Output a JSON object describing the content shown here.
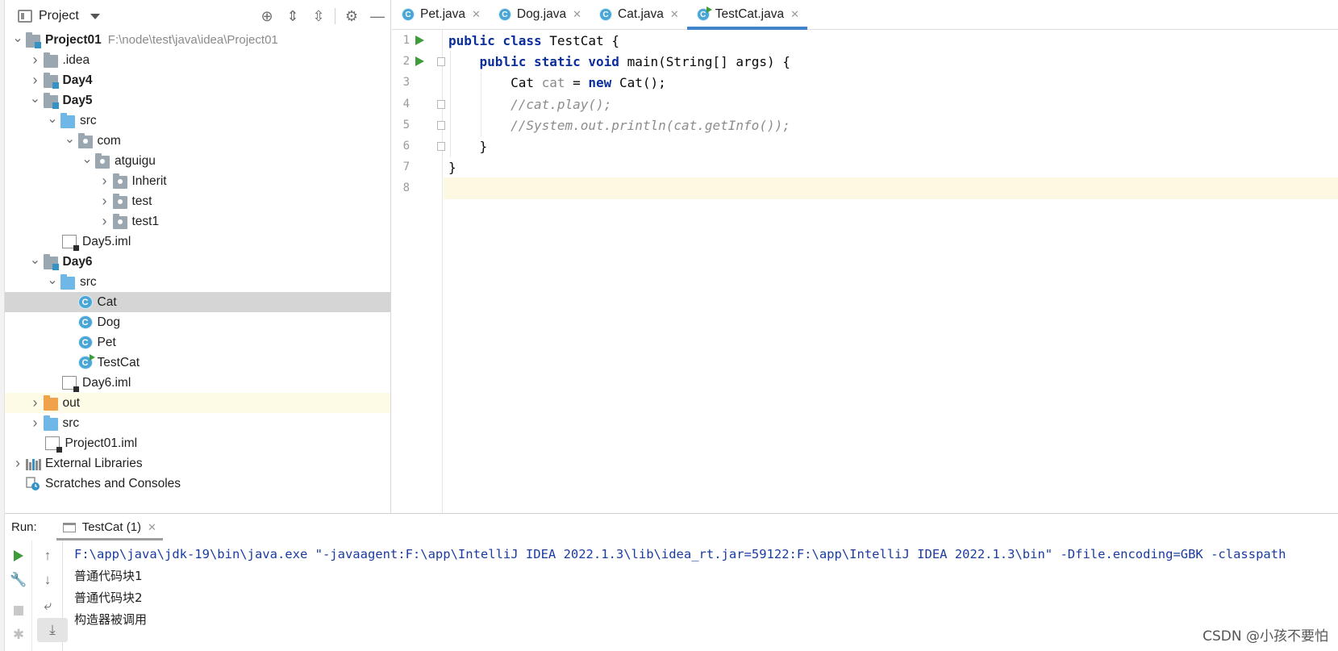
{
  "project_panel": {
    "title": "Project",
    "tree": [
      {
        "label": "Project01",
        "path": "F:\\node\\test\\java\\idea\\Project01",
        "depth": 0,
        "expanded": true,
        "icon": "module-folder",
        "bold": true
      },
      {
        "label": ".idea",
        "depth": 1,
        "expanded": false,
        "icon": "folder"
      },
      {
        "label": "Day4",
        "depth": 1,
        "expanded": false,
        "icon": "module-folder",
        "bold": true
      },
      {
        "label": "Day5",
        "depth": 1,
        "expanded": true,
        "icon": "module-folder",
        "bold": true
      },
      {
        "label": "src",
        "depth": 2,
        "expanded": true,
        "icon": "source-folder"
      },
      {
        "label": "com",
        "depth": 3,
        "expanded": true,
        "icon": "package"
      },
      {
        "label": "atguigu",
        "depth": 4,
        "expanded": true,
        "icon": "package"
      },
      {
        "label": "Inherit",
        "depth": 5,
        "expanded": false,
        "icon": "package"
      },
      {
        "label": "test",
        "depth": 5,
        "expanded": false,
        "icon": "package"
      },
      {
        "label": "test1",
        "depth": 5,
        "expanded": false,
        "icon": "package"
      },
      {
        "label": "Day5.iml",
        "depth": 2,
        "leaf": true,
        "icon": "iml-file"
      },
      {
        "label": "Day6",
        "depth": 1,
        "expanded": true,
        "icon": "module-folder",
        "bold": true
      },
      {
        "label": "src",
        "depth": 2,
        "expanded": true,
        "icon": "source-folder"
      },
      {
        "label": "Cat",
        "depth": 3,
        "leaf": true,
        "icon": "class",
        "selected": true
      },
      {
        "label": "Dog",
        "depth": 3,
        "leaf": true,
        "icon": "class"
      },
      {
        "label": "Pet",
        "depth": 3,
        "leaf": true,
        "icon": "class"
      },
      {
        "label": "TestCat",
        "depth": 3,
        "leaf": true,
        "icon": "runnable-class"
      },
      {
        "label": "Day6.iml",
        "depth": 2,
        "leaf": true,
        "icon": "iml-file"
      },
      {
        "label": "out",
        "depth": 1,
        "expanded": false,
        "icon": "excluded-folder",
        "ignored": true
      },
      {
        "label": "src",
        "depth": 1,
        "expanded": false,
        "icon": "source-folder"
      },
      {
        "label": "Project01.iml",
        "depth": 1,
        "leaf": true,
        "icon": "iml-file"
      },
      {
        "label": "External Libraries",
        "depth": 0,
        "expanded": false,
        "icon": "libraries"
      },
      {
        "label": "Scratches and Consoles",
        "depth": 0,
        "leaf": true,
        "icon": "scratches"
      }
    ]
  },
  "editor": {
    "tabs": [
      {
        "label": "Pet.java",
        "icon_letter": "C",
        "active": false
      },
      {
        "label": "Dog.java",
        "icon_letter": "C",
        "active": false
      },
      {
        "label": "Cat.java",
        "icon_letter": "C",
        "active": false
      },
      {
        "label": "TestCat.java",
        "icon_letter": "C",
        "active": true,
        "runnable": true
      }
    ],
    "line_numbers": [
      "1",
      "2",
      "3",
      "4",
      "5",
      "6",
      "7",
      "8"
    ],
    "current_line": 8,
    "run_gutter_lines": [
      1,
      2
    ],
    "fold_marker_lines": [
      2,
      4,
      5,
      6
    ],
    "code": [
      [
        {
          "t": "public class ",
          "c": "kw"
        },
        {
          "t": "TestCat {",
          "c": ""
        }
      ],
      [
        {
          "t": "    ",
          "c": ""
        },
        {
          "t": "public static void ",
          "c": "kw"
        },
        {
          "t": "main(String[] args) {",
          "c": ""
        }
      ],
      [
        {
          "t": "        Cat ",
          "c": ""
        },
        {
          "t": "cat",
          "c": "var"
        },
        {
          "t": " = ",
          "c": ""
        },
        {
          "t": "new ",
          "c": "kw"
        },
        {
          "t": "Cat();",
          "c": ""
        }
      ],
      [
        {
          "t": "        ",
          "c": ""
        },
        {
          "t": "//cat.play();",
          "c": "cmt"
        }
      ],
      [
        {
          "t": "        ",
          "c": ""
        },
        {
          "t": "//System.out.println(cat.getInfo());",
          "c": "cmt"
        }
      ],
      [
        {
          "t": "    }",
          "c": ""
        }
      ],
      [
        {
          "t": "}",
          "c": ""
        }
      ],
      [
        {
          "t": "",
          "c": ""
        }
      ]
    ]
  },
  "run_panel": {
    "label": "Run:",
    "tab_label": "TestCat (1)",
    "console": [
      {
        "text": "F:\\app\\java\\jdk-19\\bin\\java.exe \"-javaagent:F:\\app\\IntelliJ IDEA 2022.1.3\\lib\\idea_rt.jar=59122:F:\\app\\IntelliJ IDEA 2022.1.3\\bin\" -Dfile.encoding=GBK -classpath",
        "kind": "cmd"
      },
      {
        "text": "普通代码块1",
        "kind": "out"
      },
      {
        "text": "普通代码块2",
        "kind": "out"
      },
      {
        "text": "构造器被调用",
        "kind": "out"
      }
    ]
  },
  "watermark": "CSDN @小孩不要怕",
  "colors": {
    "accent": "#4083c9",
    "run_green": "#3e9d3a",
    "keyword": "#0b2f9a",
    "selection": "#d5d5d5",
    "current_line": "#fdf8e2"
  }
}
